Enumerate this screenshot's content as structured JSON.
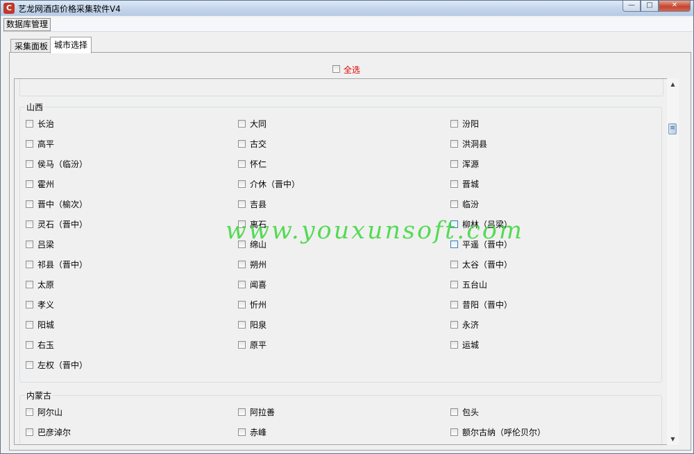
{
  "window": {
    "title": "艺龙网酒店价格采集软件V4",
    "icon": "app-logo-icon",
    "min": "—",
    "max": "□",
    "close": "✕"
  },
  "menu": {
    "database": "数据库管理"
  },
  "tabs": {
    "collect": "采集面板",
    "city": "城市选择"
  },
  "select_all": {
    "label": "全选",
    "color": "#e00000",
    "checked": false
  },
  "groups": [
    {
      "name": "山西",
      "cities": [
        {
          "label": "长治"
        },
        {
          "label": "大同"
        },
        {
          "label": "汾阳"
        },
        {
          "label": "高平"
        },
        {
          "label": "古交"
        },
        {
          "label": "洪洞县"
        },
        {
          "label": "侯马（临汾）"
        },
        {
          "label": "怀仁"
        },
        {
          "label": "浑源"
        },
        {
          "label": "霍州"
        },
        {
          "label": "介休（晋中）"
        },
        {
          "label": "晋城"
        },
        {
          "label": "晋中（榆次）"
        },
        {
          "label": "吉县"
        },
        {
          "label": "临汾"
        },
        {
          "label": "灵石（晋中）"
        },
        {
          "label": "离石"
        },
        {
          "label": "柳林（吕梁）"
        },
        {
          "label": "吕梁"
        },
        {
          "label": "绵山"
        },
        {
          "label": "平遥（晋中）"
        },
        {
          "label": "祁县（晋中）"
        },
        {
          "label": "朔州"
        },
        {
          "label": "太谷（晋中）"
        },
        {
          "label": "太原"
        },
        {
          "label": "闻喜"
        },
        {
          "label": "五台山"
        },
        {
          "label": "孝义"
        },
        {
          "label": "忻州"
        },
        {
          "label": "昔阳（晋中）"
        },
        {
          "label": "阳城"
        },
        {
          "label": "阳泉"
        },
        {
          "label": "永济"
        },
        {
          "label": "右玉"
        },
        {
          "label": "原平"
        },
        {
          "label": "运城"
        },
        {
          "label": "左权（晋中）"
        }
      ]
    },
    {
      "name": "内蒙古",
      "cities": [
        {
          "label": "阿尔山"
        },
        {
          "label": "阿拉善"
        },
        {
          "label": "包头"
        },
        {
          "label": "巴彦淖尔"
        },
        {
          "label": "赤峰"
        },
        {
          "label": "额尔古纳（呼伦贝尔）"
        }
      ]
    }
  ],
  "watermark": "www.youxunsoft.com"
}
